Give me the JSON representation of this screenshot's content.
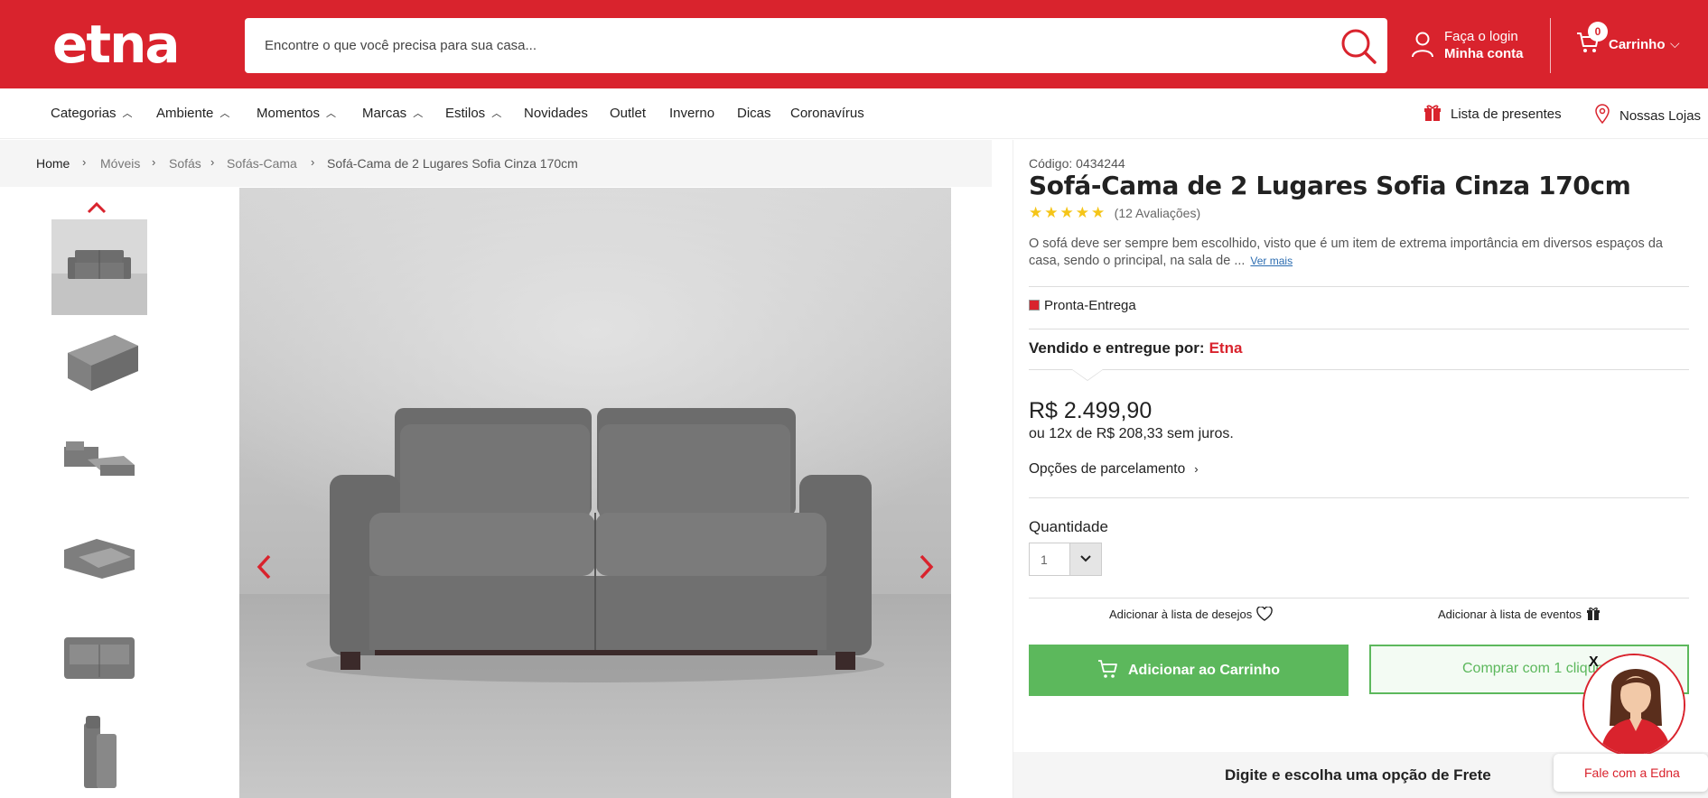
{
  "header": {
    "logo": "etna",
    "search_placeholder": "Encontre o que você precisa para sua casa...",
    "account_line1": "Faça o login",
    "account_line2": "Minha conta",
    "cart_count": "0",
    "cart_label": "Carrinho"
  },
  "nav": {
    "items": [
      "Categorias",
      "Ambiente",
      "Momentos",
      "Marcas",
      "Estilos",
      "Novidades",
      "Outlet",
      "Inverno",
      "Dicas",
      "Coronavírus"
    ],
    "gift_list": "Lista de presentes",
    "stores": "Nossas Lojas"
  },
  "breadcrumb": [
    "Home",
    "Móveis",
    "Sofás",
    "Sofás-Cama",
    "Sofá-Cama de 2 Lugares Sofia Cinza 170cm"
  ],
  "product": {
    "code_label": "Código:",
    "code": "0434244",
    "title": "Sofá-Cama de 2 Lugares Sofia Cinza 170cm",
    "stars": "★★★★★",
    "rating": 5,
    "reviews": "(12 Avaliações)",
    "description": "O sofá deve ser sempre bem escolhido, visto que é um item de extrema importância em diversos espaços da casa, sendo o principal, na sala de ...",
    "see_more": "Ver mais",
    "ready": "Pronta-Entrega",
    "sold_by_label": "Vendido e entregue por:",
    "sold_by": "Etna",
    "price": "R$ 2.499,90",
    "installments": "ou 12x de R$ 208,33 sem juros.",
    "payment_options": "Opções de parcelamento",
    "quantity_label": "Quantidade",
    "quantity": "1",
    "wishlist": "Adicionar à lista de desejos",
    "eventlist": "Adicionar à lista de eventos",
    "add_to_cart": "Adicionar ao Carrinho",
    "buy_one_click": "Comprar com 1 clique",
    "shipping": "Digite e escolha uma opção de Frete"
  },
  "chat": {
    "close": "X",
    "label": "Fale com a Edna"
  },
  "colors": {
    "brand_red": "#d9232d",
    "buy_green": "#5cb85c",
    "star_yellow": "#f5c518"
  }
}
